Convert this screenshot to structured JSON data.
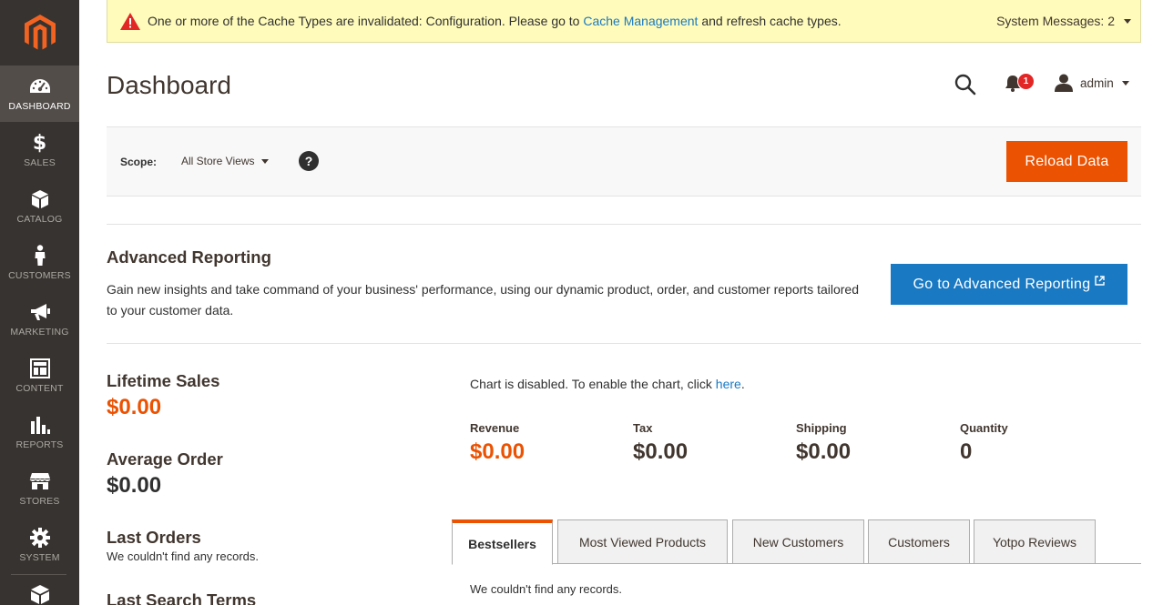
{
  "colors": {
    "sidebar": "#373330",
    "accent": "#eb5202",
    "link": "#1979c3",
    "message_bg": "#fffbbb"
  },
  "sidebar": {
    "items": [
      {
        "label": "Dashboard",
        "icon": "dashboard-icon",
        "active": true
      },
      {
        "label": "Sales",
        "icon": "dollar-icon"
      },
      {
        "label": "Catalog",
        "icon": "box-icon"
      },
      {
        "label": "Customers",
        "icon": "person-icon"
      },
      {
        "label": "Marketing",
        "icon": "megaphone-icon"
      },
      {
        "label": "Content",
        "icon": "layout-icon"
      },
      {
        "label": "Reports",
        "icon": "bar-chart-icon"
      },
      {
        "label": "Stores",
        "icon": "store-icon"
      },
      {
        "label": "System",
        "icon": "gear-icon"
      }
    ]
  },
  "message": {
    "before": "One or more of the Cache Types are invalidated: Configuration. Please go to ",
    "link": "Cache Management",
    "after": " and refresh cache types.",
    "system_messages": "System Messages: 2"
  },
  "header": {
    "title": "Dashboard",
    "notifications_count": "1",
    "user": "admin"
  },
  "scope": {
    "label": "Scope:",
    "selected": "All Store Views",
    "help": "?",
    "reload_label": "Reload Data"
  },
  "advanced": {
    "title": "Advanced Reporting",
    "description": "Gain new insights and take command of your business' performance, using our dynamic product, order, and customer reports tailored to your customer data.",
    "button": "Go to Advanced Reporting"
  },
  "stats": {
    "lifetime_sales_label": "Lifetime Sales",
    "lifetime_sales_value": "$0.00",
    "average_order_label": "Average Order",
    "average_order_value": "$0.00",
    "last_orders_label": "Last Orders",
    "last_orders_note": "We couldn't find any records.",
    "last_search_label": "Last Search Terms"
  },
  "chart": {
    "message_before": "Chart is disabled. To enable the chart, click ",
    "message_link": "here",
    "message_after": "."
  },
  "totals": [
    {
      "label": "Revenue",
      "value": "$0.00"
    },
    {
      "label": "Tax",
      "value": "$0.00"
    },
    {
      "label": "Shipping",
      "value": "$0.00"
    },
    {
      "label": "Quantity",
      "value": "0"
    }
  ],
  "tabs": [
    {
      "label": "Bestsellers",
      "active": true
    },
    {
      "label": "Most Viewed Products"
    },
    {
      "label": "New Customers"
    },
    {
      "label": "Customers"
    },
    {
      "label": "Yotpo Reviews"
    }
  ],
  "tab_content": "We couldn't find any records."
}
